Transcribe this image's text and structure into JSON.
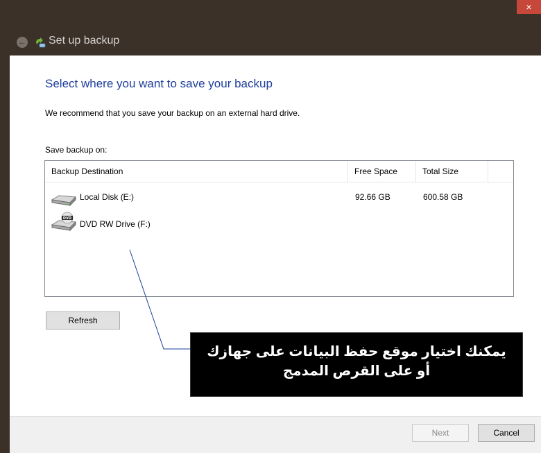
{
  "window": {
    "title": "Set up backup",
    "close_label": "×"
  },
  "page": {
    "heading": "Select where you want to save your backup",
    "recommendation": "We recommend that you save your backup on an external hard drive.",
    "save_label": "Save backup on:"
  },
  "table": {
    "columns": [
      "Backup Destination",
      "Free Space",
      "Total Size"
    ],
    "rows": [
      {
        "name": "Local Disk (E:)",
        "free": "92.66 GB",
        "total": "600.58 GB",
        "icon": "hard-drive-icon"
      },
      {
        "name": "DVD RW Drive (F:)",
        "free": "",
        "total": "",
        "icon": "dvd-drive-icon"
      }
    ]
  },
  "buttons": {
    "refresh": "Refresh",
    "next": "Next",
    "cancel": "Cancel"
  },
  "annotation": {
    "line1": "يمكنك اختيار موقع حفظ البيانات على جهازك",
    "line2": "أو على القرص المدمج"
  },
  "colors": {
    "heading": "#1e3f9a",
    "frame": "#3b3129",
    "close": "#c7483b"
  }
}
